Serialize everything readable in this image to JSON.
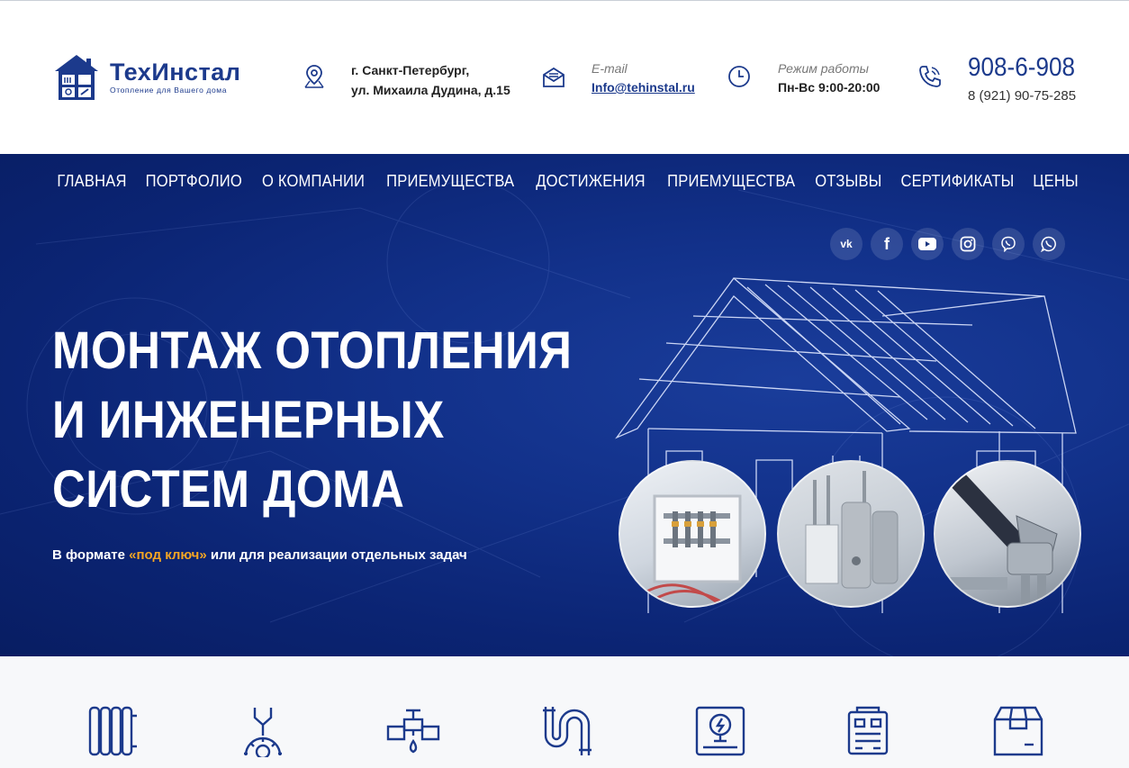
{
  "brand": {
    "name": "ТехИнстал",
    "tagline": "Отопление для Вашего дома"
  },
  "contacts": {
    "address_line1": "г. Санкт-Петербург,",
    "address_line2": "ул. Михаила Дудина, д.15",
    "email_label": "E-mail",
    "email_value": "Info@tehinstal.ru",
    "hours_label": "Режим работы",
    "hours_value": "Пн-Вс 9:00-20:00",
    "phone_main": "908-6-908",
    "phone_secondary": "8 (921) 90-75-285"
  },
  "nav": {
    "items": [
      {
        "label": "ГЛАВНАЯ"
      },
      {
        "label": "ПОРТФОЛИО"
      },
      {
        "label": "О КОМПАНИИ"
      },
      {
        "label": "ПРИЕМУЩЕСТВА"
      },
      {
        "label": "ДОСТИЖЕНИЯ"
      },
      {
        "label": "ПРИЕМУЩЕСТВА"
      },
      {
        "label": "ОТЗЫВЫ"
      },
      {
        "label": "СЕРТИФИКАТЫ"
      },
      {
        "label": "ЦЕНЫ"
      }
    ]
  },
  "socials": [
    {
      "icon": "vk-icon",
      "glyph": "vk"
    },
    {
      "icon": "facebook-icon",
      "glyph": "f"
    },
    {
      "icon": "youtube-icon",
      "glyph": "▶"
    },
    {
      "icon": "instagram-icon",
      "glyph": "◎"
    },
    {
      "icon": "viber-icon",
      "glyph": "✆"
    },
    {
      "icon": "whatsapp-icon",
      "glyph": "✆"
    }
  ],
  "hero": {
    "title_line1": "МОНТАЖ ОТОПЛЕНИЯ",
    "title_line2": "И ИНЖЕНЕРНЫХ",
    "title_line3": "СИСТЕМ ДОМА",
    "subtitle_before": "В формате ",
    "subtitle_accent": "«под ключ»",
    "subtitle_after": " или для реализации отдельных задач"
  },
  "services": [
    {
      "icon": "radiator-icon"
    },
    {
      "icon": "wrench-gear-icon"
    },
    {
      "icon": "water-valve-icon"
    },
    {
      "icon": "pipe-icon"
    },
    {
      "icon": "boiler-icon"
    },
    {
      "icon": "generator-icon"
    },
    {
      "icon": "box-icon"
    }
  ],
  "colors": {
    "brand_blue": "#1c3a8c",
    "hero_bg": "#0b2473",
    "accent_orange": "#f5a623"
  }
}
